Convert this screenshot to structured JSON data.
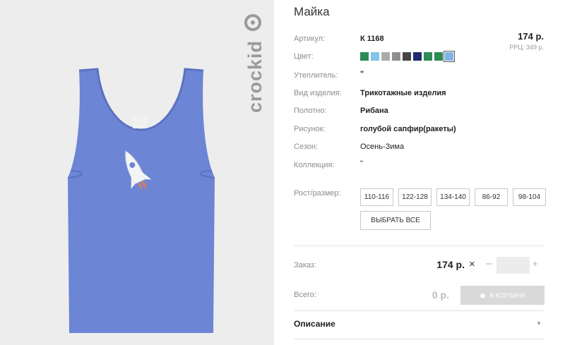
{
  "product": {
    "title": "Майка",
    "price": "174 р.",
    "rrc": "РРЦ: 349 р."
  },
  "brand": {
    "logo_text": "crockid"
  },
  "attributes": [
    {
      "label": "Артикул:",
      "value": "К 1168"
    },
    {
      "label": "Цвет:",
      "value": ""
    },
    {
      "label": "Утеплитель:",
      "value": "\""
    },
    {
      "label": "Вид изделия:",
      "value": "Трикотажные изделия"
    },
    {
      "label": "Полотно:",
      "value": "Рибана"
    },
    {
      "label": "Рисунок:",
      "value": "голубой сапфир(ракеты)"
    },
    {
      "label": "Сезон:",
      "value": "Осень-Зима"
    },
    {
      "label": "Коллекция:",
      "value": "\""
    }
  ],
  "colors": [
    "#2f8a55",
    "#7fc4ea",
    "#aaaaaa",
    "#8f8f8f",
    "#444444",
    "#1f2b6e",
    "#2f8a55",
    "#2f8a55",
    "#7fb3e8"
  ],
  "size_label": "Рост/размер:",
  "sizes": [
    "110-116",
    "122-128",
    "134-140",
    "86-92",
    "98-104"
  ],
  "select_all": "ВЫБРАТЬ ВСЕ",
  "order": {
    "label": "Заказ:",
    "price": "174 р.",
    "times": "×",
    "minus": "–",
    "plus": "+",
    "qty": ""
  },
  "total": {
    "label": "Всего:",
    "value": "0 р.",
    "cart_button": "В КОРЗИНУ"
  },
  "description": {
    "label": "Описание"
  }
}
